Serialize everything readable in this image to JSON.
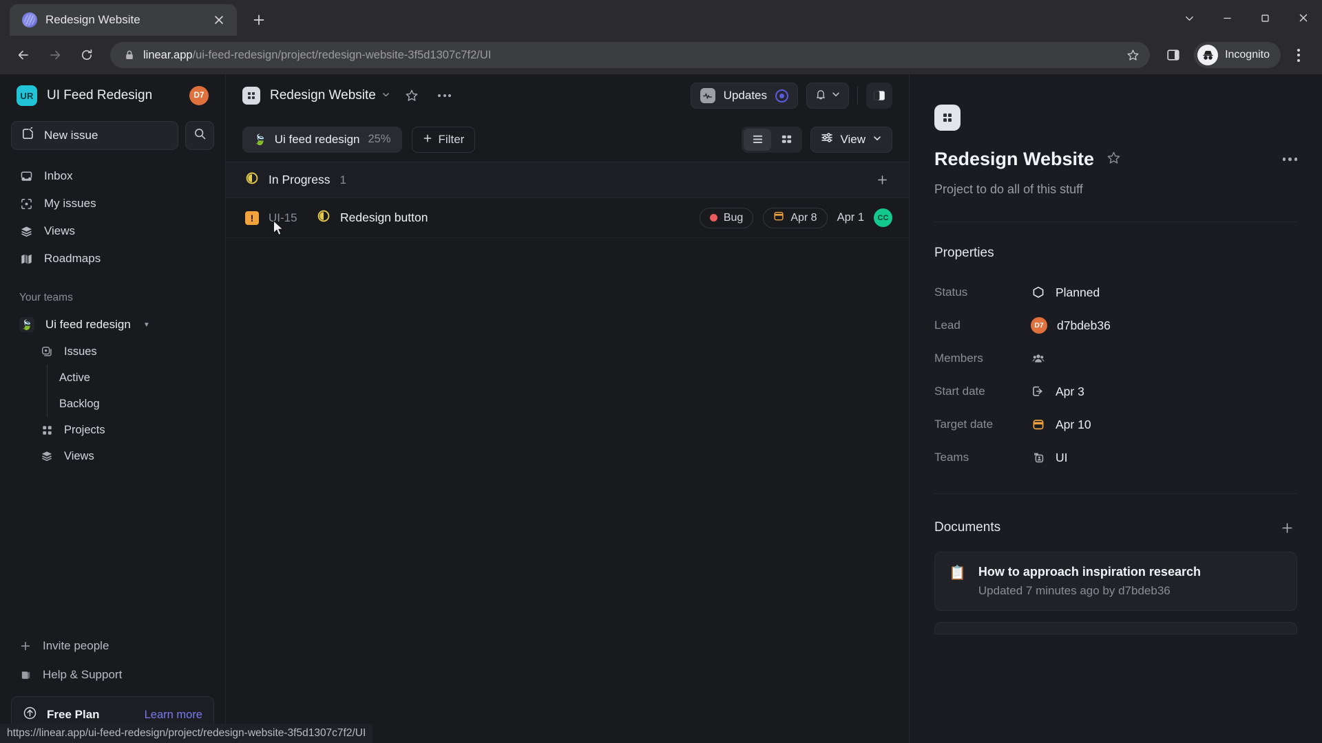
{
  "browser": {
    "tab": {
      "title": "Redesign Website",
      "favicon": "linear-logo-icon",
      "close": "close-icon"
    },
    "new_tab": "+",
    "window_controls": {
      "minimize_all": "chevron-down-icon",
      "minimize": "minimize-icon",
      "maximize": "maximize-icon",
      "close": "close-icon"
    },
    "nav": {
      "back": "back-arrow-icon",
      "forward": "forward-arrow-icon",
      "reload": "reload-icon"
    },
    "omnibox": {
      "lock": "lock-icon",
      "host": "linear.app",
      "path": "/ui-feed-redesign/project/redesign-website-3f5d1307c7f2/UI",
      "bookmark": "star-icon"
    },
    "side_panel": "side-panel-icon",
    "profile": {
      "label": "Incognito",
      "icon": "incognito-icon"
    },
    "menu": "three-dot-menu-icon",
    "status_url": "https://linear.app/ui-feed-redesign/project/redesign-website-3f5d1307c7f2/UI"
  },
  "sidebar": {
    "workspace": {
      "initials": "UR",
      "name": "UI Feed Redesign",
      "avatar_initials": "D7"
    },
    "new_issue": {
      "label": "New issue",
      "icon": "compose-icon"
    },
    "search": {
      "icon": "search-icon"
    },
    "nav": [
      {
        "label": "Inbox",
        "icon": "inbox-icon"
      },
      {
        "label": "My issues",
        "icon": "target-icon"
      },
      {
        "label": "Views",
        "icon": "layers-icon"
      },
      {
        "label": "Roadmaps",
        "icon": "map-icon"
      }
    ],
    "teams_label": "Your teams",
    "team": {
      "name": "Ui feed redesign",
      "emoji": "🍃",
      "caret": "caret-down-icon"
    },
    "team_nav": [
      {
        "label": "Issues",
        "icon": "issues-icon"
      },
      {
        "label": "Projects",
        "icon": "projects-grid-icon"
      },
      {
        "label": "Views",
        "icon": "layers-icon"
      }
    ],
    "issue_children": [
      {
        "label": "Active"
      },
      {
        "label": "Backlog"
      }
    ],
    "footer": [
      {
        "label": "Invite people",
        "icon": "plus-icon"
      },
      {
        "label": "Help & Support",
        "icon": "book-icon"
      }
    ],
    "plan": {
      "icon": "upgrade-arrow-icon",
      "name": "Free Plan",
      "link": "Learn more"
    }
  },
  "header": {
    "project_icon": "project-grid-icon",
    "title": "Redesign Website",
    "caret": "chevron-down-icon",
    "favorite": "star-icon",
    "more": "more-options-icon",
    "updates": {
      "label": "Updates",
      "icon": "activity-icon",
      "badge": "target-ring-icon"
    },
    "notifications": {
      "icon": "bell-icon",
      "caret": "chevron-down-icon"
    },
    "panel_toggle": "right-panel-toggle-icon"
  },
  "filter_bar": {
    "team_pill": {
      "emoji": "🍃",
      "label": "Ui feed redesign",
      "percent": "25%"
    },
    "filter": {
      "label": "Filter",
      "icon": "plus-icon"
    },
    "view_list": "list-view-icon",
    "view_board": "board-view-icon",
    "view": {
      "label": "View",
      "icon": "sliders-icon",
      "caret": "chevron-down-icon"
    }
  },
  "issue_list": {
    "group": {
      "status_icon": "in-progress-icon",
      "title": "In Progress",
      "count": "1",
      "add": "plus-icon"
    },
    "rows": [
      {
        "priority_icon": "urgent-priority-icon",
        "id": "UI-15",
        "status_icon": "in-progress-icon",
        "title": "Redesign button",
        "label": "Bug",
        "label_color": "#ec5b5b",
        "due_date": "Apr 8",
        "date": "Apr 1",
        "assignee_initials": "CC"
      }
    ]
  },
  "right_panel": {
    "icon": "project-grid-icon",
    "title": "Redesign Website",
    "favorite": "star-icon",
    "more": "more-options-icon",
    "description": "Project to do all of this stuff",
    "properties_title": "Properties",
    "properties": [
      {
        "key": "Status",
        "value": "Planned",
        "icon": "hexagon-outline-icon"
      },
      {
        "key": "Lead",
        "value": "d7bdeb36",
        "icon": "avatar",
        "avatar_initials": "D7"
      },
      {
        "key": "Members",
        "value": "",
        "icon": "members-group-icon"
      },
      {
        "key": "Start date",
        "value": "Apr 3",
        "icon": "start-date-icon"
      },
      {
        "key": "Target date",
        "value": "Apr 10",
        "icon": "target-date-icon"
      },
      {
        "key": "Teams",
        "value": "UI",
        "icon": "teams-icon"
      }
    ],
    "documents_title": "Documents",
    "documents_add": "plus-icon",
    "documents": [
      {
        "icon": "📋",
        "name": "How to approach inspiration research",
        "subtitle": "Updated 7 minutes ago by d7bdeb36"
      }
    ]
  }
}
